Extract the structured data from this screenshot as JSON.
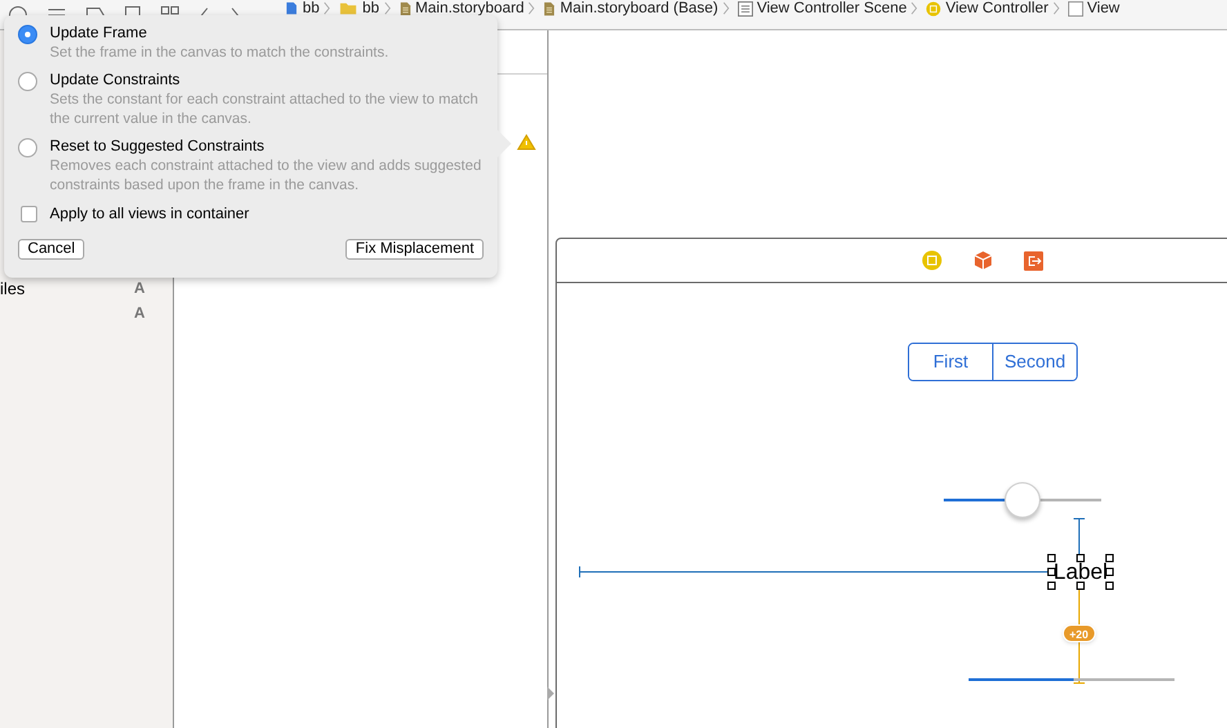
{
  "toolbar": {
    "breadcrumbs": [
      {
        "label": "bb",
        "kind": "project"
      },
      {
        "label": "bb",
        "kind": "folder"
      },
      {
        "label": "Main.storyboard",
        "kind": "storyboard"
      },
      {
        "label": "Main.storyboard (Base)",
        "kind": "storyboard"
      },
      {
        "label": "View Controller Scene",
        "kind": "scene"
      },
      {
        "label": "View Controller",
        "kind": "controller"
      },
      {
        "label": "View",
        "kind": "view"
      }
    ]
  },
  "navigator": {
    "rows": [
      {
        "label": "iles",
        "badge": "A"
      },
      {
        "badge": "A"
      }
    ]
  },
  "popover": {
    "options": [
      {
        "label": "Update Frame",
        "description": "Set the frame in the canvas to match the constraints.",
        "selected": true
      },
      {
        "label": "Update Constraints",
        "description": "Sets the constant for each constraint attached to the view to match the current value in the canvas.",
        "selected": false
      },
      {
        "label": "Reset to Suggested Constraints",
        "description": "Removes each constraint attached to the view and adds suggested constraints based upon the frame in the canvas.",
        "selected": false
      }
    ],
    "apply_all": {
      "label": "Apply to all views in container",
      "checked": false
    },
    "buttons": [
      "Cancel",
      "Fix Misplacement"
    ]
  },
  "scene": {
    "segments": [
      {
        "label": "First",
        "selected": false
      },
      {
        "label": "Second",
        "selected": false
      }
    ],
    "slider": {
      "level": 0.5
    },
    "label": "Label",
    "constraint_badge": "+20",
    "progress": {
      "level": 0.51
    }
  }
}
